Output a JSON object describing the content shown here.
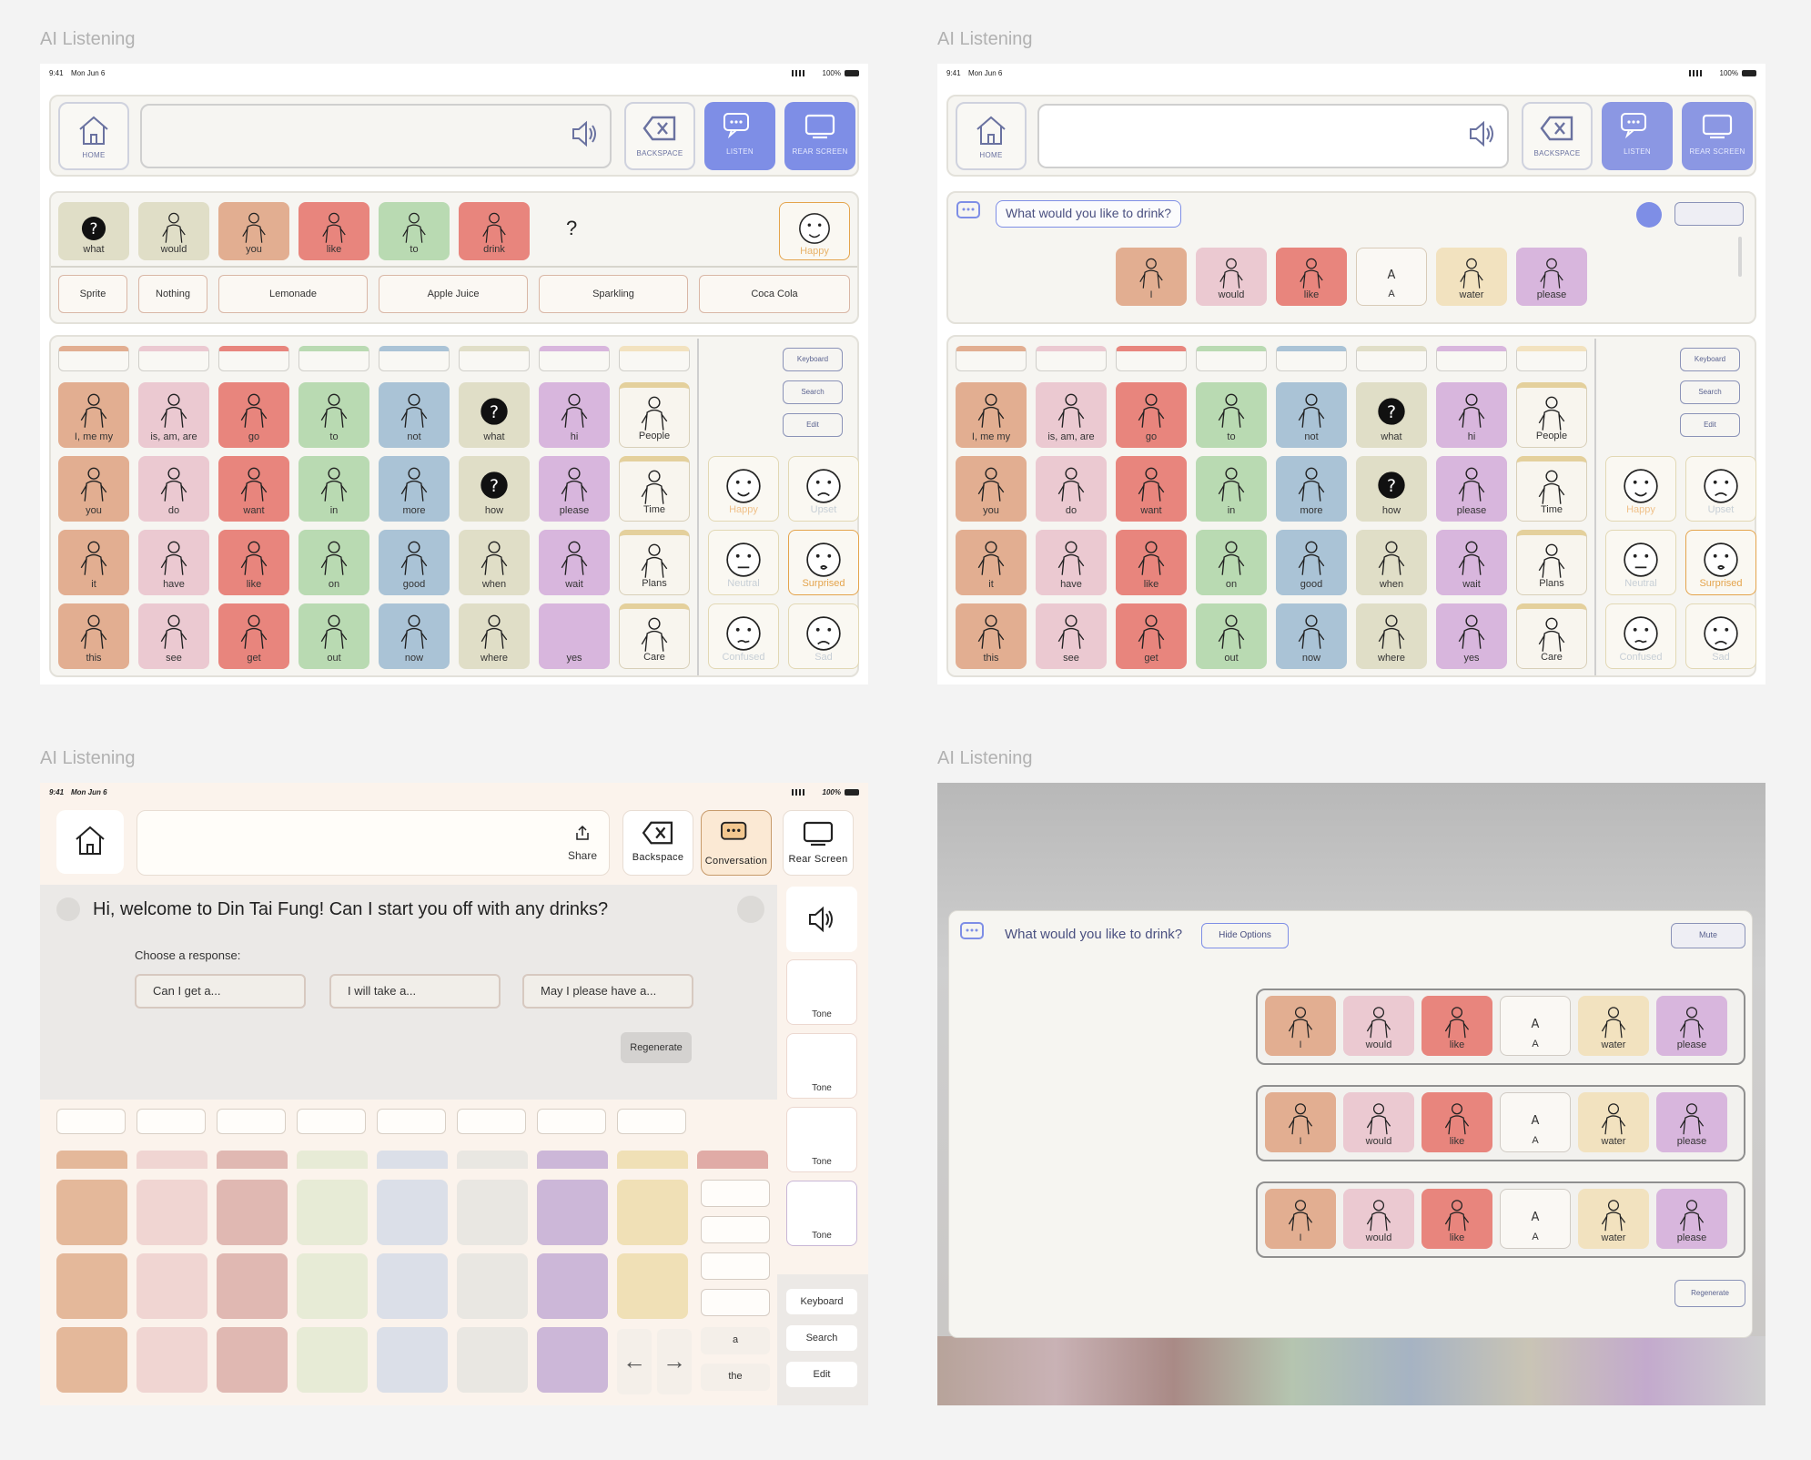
{
  "panels": [
    {
      "title": "AI Listening"
    },
    {
      "title": "AI Listening"
    },
    {
      "title": "AI Listening"
    },
    {
      "title": "AI Listening"
    }
  ],
  "status": {
    "time": "9:41",
    "date": "Mon Jun 6",
    "battery": "100%"
  },
  "controls": {
    "home": "HOME",
    "backspace": "BACKSPACE",
    "listen": "LISTEN",
    "rear": "REAR SCREEN"
  },
  "p1": {
    "sentence": [
      "what",
      "would",
      "you",
      "like",
      "to",
      "drink",
      "?"
    ],
    "mood": "Happy",
    "suggestions": [
      "Sprite",
      "Nothing",
      "Lemonade",
      "Apple Juice",
      "Sparkling",
      "Coca Cola"
    ]
  },
  "grid": [
    [
      "I, me my",
      "is, am, are",
      "go",
      "to",
      "not",
      "what",
      "hi",
      "People"
    ],
    [
      "you",
      "do",
      "want",
      "in",
      "more",
      "how",
      "please",
      "Time"
    ],
    [
      "it",
      "have",
      "like",
      "on",
      "good",
      "when",
      "wait",
      "Plans"
    ],
    [
      "this",
      "see",
      "get",
      "out",
      "now",
      "where",
      "yes",
      "Care"
    ]
  ],
  "emotions": [
    "Happy",
    "Upset",
    "Neutral",
    "Surprised",
    "Confused",
    "Sad"
  ],
  "tools": [
    "Keyboard",
    "Search",
    "Edit"
  ],
  "p2": {
    "question": "What would you like to drink?",
    "words": [
      "I",
      "would",
      "like",
      "A",
      "water",
      "please"
    ]
  },
  "p3": {
    "share": "Share",
    "backspace": "Backspace",
    "conversation": "Conversation",
    "rear": "Rear Screen",
    "message": "Hi, welcome to Din Tai Fung! Can I start you off with any drinks?",
    "choose": "Choose a response:",
    "responses": [
      "Can I get a...",
      "I will take a...",
      "May I please have a..."
    ],
    "regenerate": "Regenerate",
    "tone": "Tone",
    "small": [
      "a",
      "the"
    ],
    "tools": [
      "Keyboard",
      "Search",
      "Edit"
    ]
  },
  "p4": {
    "question": "What would you like to drink?",
    "hide": "Hide Options",
    "mute": "Mute",
    "words": [
      "I",
      "would",
      "like",
      "A",
      "water",
      "please"
    ],
    "regenerate": "Regenerate"
  }
}
